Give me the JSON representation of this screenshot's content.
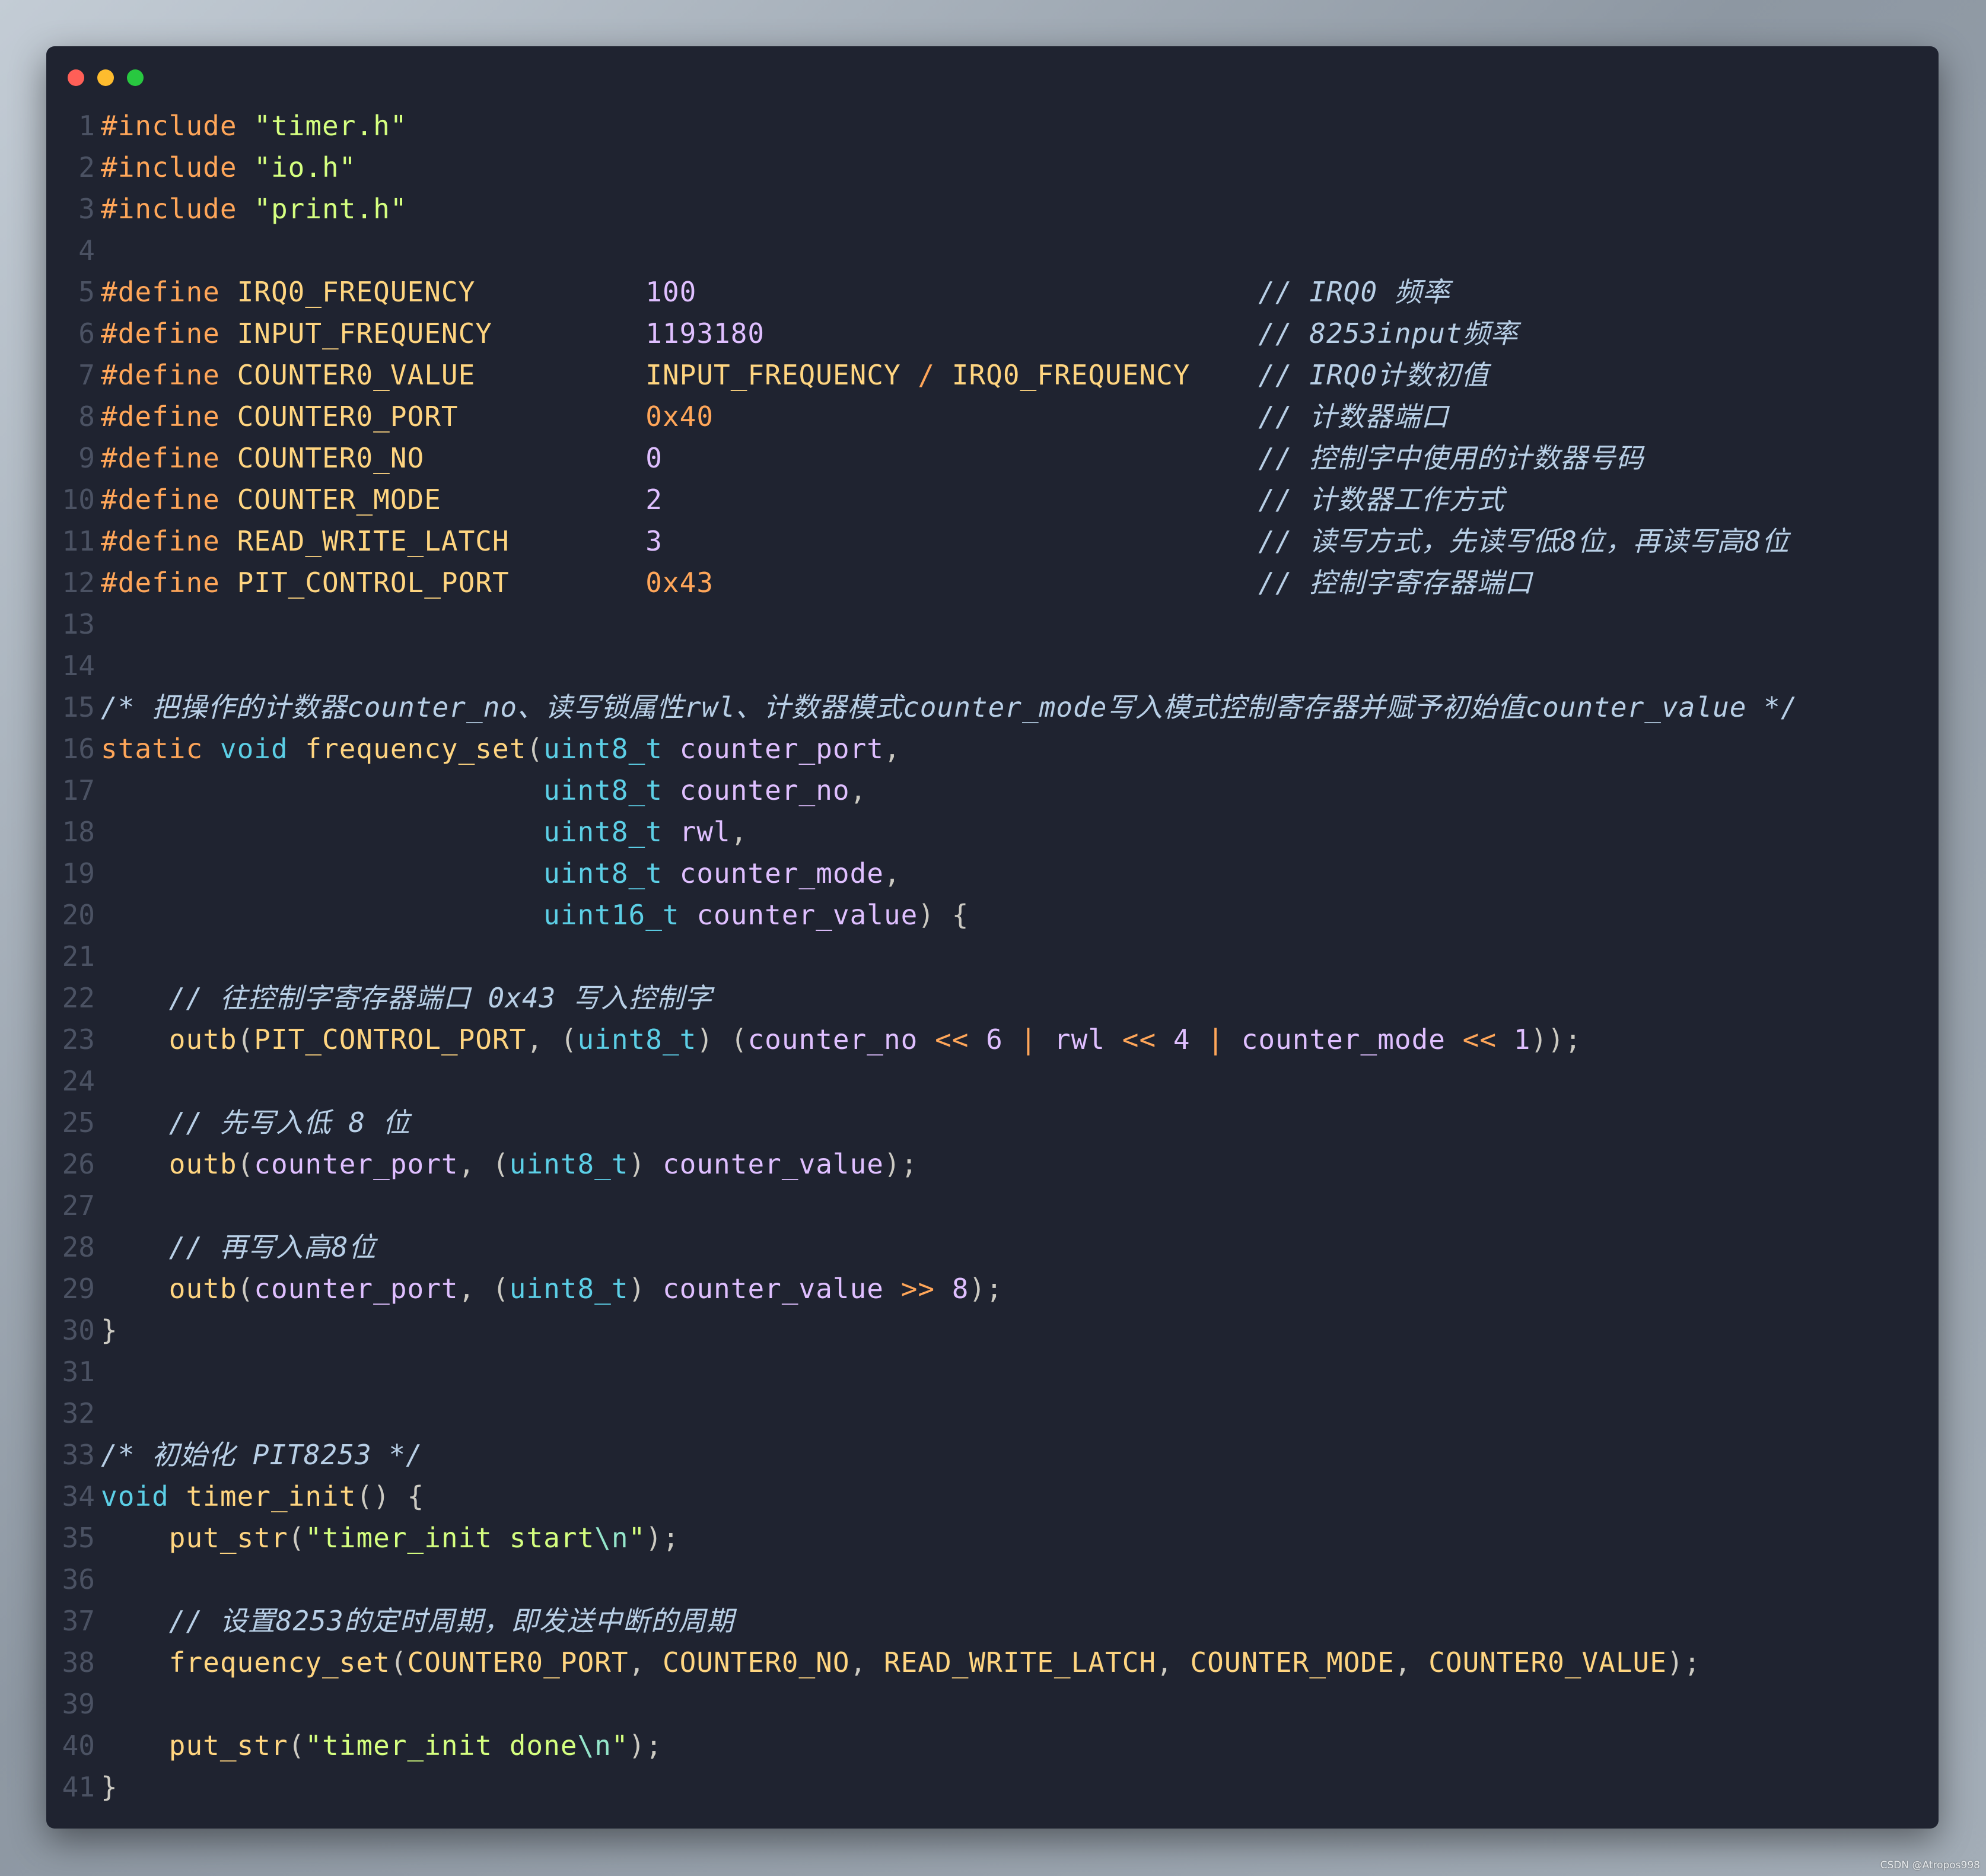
{
  "window": {
    "controls": [
      {
        "name": "close",
        "color": "#ff5f57"
      },
      {
        "name": "minimize",
        "color": "#febc2e"
      },
      {
        "name": "maximize",
        "color": "#28c840"
      }
    ]
  },
  "watermark": "CSDN @Atropos998",
  "code_lines": [
    [
      [
        "kw",
        "#include"
      ],
      [
        "p",
        " "
      ],
      [
        "str",
        "\"timer.h\""
      ]
    ],
    [
      [
        "kw",
        "#include"
      ],
      [
        "p",
        " "
      ],
      [
        "str",
        "\"io.h\""
      ]
    ],
    [
      [
        "kw",
        "#include"
      ],
      [
        "p",
        " "
      ],
      [
        "str",
        "\"print.h\""
      ]
    ],
    [],
    [
      [
        "kw",
        "#define"
      ],
      [
        "p",
        " "
      ],
      [
        "mac",
        "IRQ0_FREQUENCY"
      ],
      [
        "p",
        "          "
      ],
      [
        "num",
        "100"
      ],
      [
        "p",
        "                                 "
      ],
      [
        "cmt",
        "// IRQ0 频率"
      ]
    ],
    [
      [
        "kw",
        "#define"
      ],
      [
        "p",
        " "
      ],
      [
        "mac",
        "INPUT_FREQUENCY"
      ],
      [
        "p",
        "         "
      ],
      [
        "num",
        "1193180"
      ],
      [
        "p",
        "                             "
      ],
      [
        "cmt",
        "// 8253input频率"
      ]
    ],
    [
      [
        "kw",
        "#define"
      ],
      [
        "p",
        " "
      ],
      [
        "mac",
        "COUNTER0_VALUE"
      ],
      [
        "p",
        "          "
      ],
      [
        "mac",
        "INPUT_FREQUENCY"
      ],
      [
        "op",
        " / "
      ],
      [
        "mac",
        "IRQ0_FREQUENCY"
      ],
      [
        "p",
        "    "
      ],
      [
        "cmt",
        "// IRQ0计数初值"
      ]
    ],
    [
      [
        "kw",
        "#define"
      ],
      [
        "p",
        " "
      ],
      [
        "mac",
        "COUNTER0_PORT"
      ],
      [
        "p",
        "           "
      ],
      [
        "hex",
        "0x40"
      ],
      [
        "p",
        "                                "
      ],
      [
        "cmt",
        "// 计数器端口"
      ]
    ],
    [
      [
        "kw",
        "#define"
      ],
      [
        "p",
        " "
      ],
      [
        "mac",
        "COUNTER0_NO"
      ],
      [
        "p",
        "             "
      ],
      [
        "num",
        "0"
      ],
      [
        "p",
        "                                   "
      ],
      [
        "cmt",
        "// 控制字中使用的计数器号码"
      ]
    ],
    [
      [
        "kw",
        "#define"
      ],
      [
        "p",
        " "
      ],
      [
        "mac",
        "COUNTER_MODE"
      ],
      [
        "p",
        "            "
      ],
      [
        "num",
        "2"
      ],
      [
        "p",
        "                                   "
      ],
      [
        "cmt",
        "// 计数器工作方式"
      ]
    ],
    [
      [
        "kw",
        "#define"
      ],
      [
        "p",
        " "
      ],
      [
        "mac",
        "READ_WRITE_LATCH"
      ],
      [
        "p",
        "        "
      ],
      [
        "num",
        "3"
      ],
      [
        "p",
        "                                   "
      ],
      [
        "cmt",
        "// 读写方式，先读写低8位，再读写高8位"
      ]
    ],
    [
      [
        "kw",
        "#define"
      ],
      [
        "p",
        " "
      ],
      [
        "mac",
        "PIT_CONTROL_PORT"
      ],
      [
        "p",
        "        "
      ],
      [
        "hex",
        "0x43"
      ],
      [
        "p",
        "                                "
      ],
      [
        "cmt",
        "// 控制字寄存器端口"
      ]
    ],
    [],
    [],
    [
      [
        "cmt",
        "/* 把操作的计数器counter_no、读写锁属性rwl、计数器模式counter_mode写入模式控制寄存器并赋予初始值counter_value */"
      ]
    ],
    [
      [
        "kw",
        "static"
      ],
      [
        "p",
        " "
      ],
      [
        "type",
        "void"
      ],
      [
        "p",
        " "
      ],
      [
        "fn",
        "frequency_set"
      ],
      [
        "punc",
        "("
      ],
      [
        "type",
        "uint8_t"
      ],
      [
        "p",
        " "
      ],
      [
        "var",
        "counter_port"
      ],
      [
        "punc",
        ","
      ]
    ],
    [
      [
        "p",
        "                          "
      ],
      [
        "type",
        "uint8_t"
      ],
      [
        "p",
        " "
      ],
      [
        "var",
        "counter_no"
      ],
      [
        "punc",
        ","
      ]
    ],
    [
      [
        "p",
        "                          "
      ],
      [
        "type",
        "uint8_t"
      ],
      [
        "p",
        " "
      ],
      [
        "var",
        "rwl"
      ],
      [
        "punc",
        ","
      ]
    ],
    [
      [
        "p",
        "                          "
      ],
      [
        "type",
        "uint8_t"
      ],
      [
        "p",
        " "
      ],
      [
        "var",
        "counter_mode"
      ],
      [
        "punc",
        ","
      ]
    ],
    [
      [
        "p",
        "                          "
      ],
      [
        "type",
        "uint16_t"
      ],
      [
        "p",
        " "
      ],
      [
        "var",
        "counter_value"
      ],
      [
        "punc",
        ") {"
      ]
    ],
    [],
    [
      [
        "p",
        "    "
      ],
      [
        "cmt",
        "// 往控制字寄存器端口 0x43 写入控制字"
      ]
    ],
    [
      [
        "p",
        "    "
      ],
      [
        "fn",
        "outb"
      ],
      [
        "punc",
        "("
      ],
      [
        "mac",
        "PIT_CONTROL_PORT"
      ],
      [
        "punc",
        ", ("
      ],
      [
        "type",
        "uint8_t"
      ],
      [
        "punc",
        ") ("
      ],
      [
        "var",
        "counter_no"
      ],
      [
        "op",
        " << "
      ],
      [
        "num",
        "6"
      ],
      [
        "op",
        " | "
      ],
      [
        "var",
        "rwl"
      ],
      [
        "op",
        " << "
      ],
      [
        "num",
        "4"
      ],
      [
        "op",
        " | "
      ],
      [
        "var",
        "counter_mode"
      ],
      [
        "op",
        " << "
      ],
      [
        "num",
        "1"
      ],
      [
        "punc",
        "));"
      ]
    ],
    [],
    [
      [
        "p",
        "    "
      ],
      [
        "cmt",
        "// 先写入低 8 位"
      ]
    ],
    [
      [
        "p",
        "    "
      ],
      [
        "fn",
        "outb"
      ],
      [
        "punc",
        "("
      ],
      [
        "var",
        "counter_port"
      ],
      [
        "punc",
        ", ("
      ],
      [
        "type",
        "uint8_t"
      ],
      [
        "punc",
        ") "
      ],
      [
        "var",
        "counter_value"
      ],
      [
        "punc",
        ");"
      ]
    ],
    [],
    [
      [
        "p",
        "    "
      ],
      [
        "cmt",
        "// 再写入高8位"
      ]
    ],
    [
      [
        "p",
        "    "
      ],
      [
        "fn",
        "outb"
      ],
      [
        "punc",
        "("
      ],
      [
        "var",
        "counter_port"
      ],
      [
        "punc",
        ", ("
      ],
      [
        "type",
        "uint8_t"
      ],
      [
        "punc",
        ") "
      ],
      [
        "var",
        "counter_value"
      ],
      [
        "op",
        " >> "
      ],
      [
        "num",
        "8"
      ],
      [
        "punc",
        ");"
      ]
    ],
    [
      [
        "punc",
        "}"
      ]
    ],
    [],
    [],
    [
      [
        "cmt",
        "/* 初始化 PIT8253 */"
      ]
    ],
    [
      [
        "type",
        "void"
      ],
      [
        "p",
        " "
      ],
      [
        "fn",
        "timer_init"
      ],
      [
        "punc",
        "() {"
      ]
    ],
    [
      [
        "p",
        "    "
      ],
      [
        "fn",
        "put_str"
      ],
      [
        "punc",
        "("
      ],
      [
        "str",
        "\"timer_init start"
      ],
      [
        "esc",
        "\\n"
      ],
      [
        "str",
        "\""
      ],
      [
        "punc",
        ");"
      ]
    ],
    [],
    [
      [
        "p",
        "    "
      ],
      [
        "cmt",
        "// 设置8253的定时周期，即发送中断的周期"
      ]
    ],
    [
      [
        "p",
        "    "
      ],
      [
        "fn",
        "frequency_set"
      ],
      [
        "punc",
        "("
      ],
      [
        "mac",
        "COUNTER0_PORT"
      ],
      [
        "punc",
        ", "
      ],
      [
        "mac",
        "COUNTER0_NO"
      ],
      [
        "punc",
        ", "
      ],
      [
        "mac",
        "READ_WRITE_LATCH"
      ],
      [
        "punc",
        ", "
      ],
      [
        "mac",
        "COUNTER_MODE"
      ],
      [
        "punc",
        ", "
      ],
      [
        "mac",
        "COUNTER0_VALUE"
      ],
      [
        "punc",
        ");"
      ]
    ],
    [],
    [
      [
        "p",
        "    "
      ],
      [
        "fn",
        "put_str"
      ],
      [
        "punc",
        "("
      ],
      [
        "str",
        "\"timer_init done"
      ],
      [
        "esc",
        "\\n"
      ],
      [
        "str",
        "\""
      ],
      [
        "punc",
        ");"
      ]
    ],
    [
      [
        "punc",
        "}"
      ]
    ]
  ]
}
